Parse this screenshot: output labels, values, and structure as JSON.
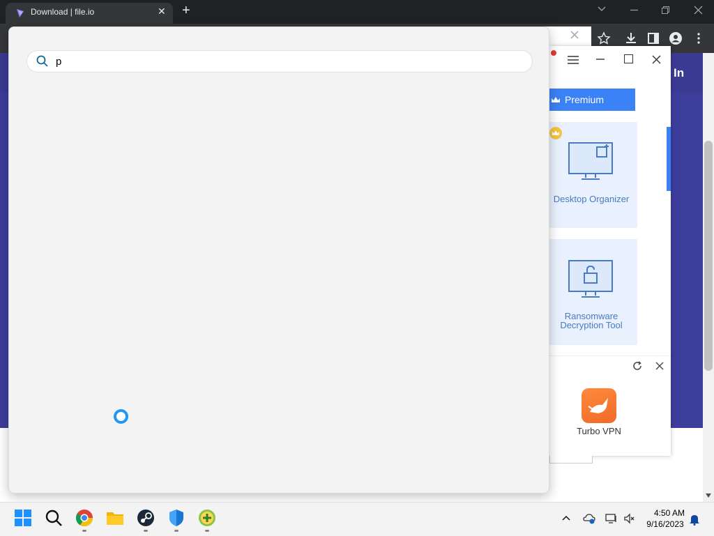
{
  "browser": {
    "tab_title": "Download | file.io",
    "tab_close": "✕",
    "new_tab": "+"
  },
  "page": {
    "sign_in_fragment": "In"
  },
  "app_panel": {
    "premium_label": "Premium",
    "tiles": [
      {
        "label": "Desktop Organizer",
        "icon": "monitor-window-icon"
      },
      {
        "label_line1": "Ransomware",
        "label_line2": "Decryption Tool",
        "icon": "monitor-lock-icon"
      }
    ],
    "promo": {
      "label": "Turbo VPN",
      "icon": "rabbit-icon"
    }
  },
  "search": {
    "query": "p"
  },
  "taskbar": {
    "time": "4:50 AM",
    "date": "9/16/2023"
  },
  "colors": {
    "page_header": "#3b3a93",
    "page_body": "#3d3d9c",
    "accent": "#3b82f6",
    "search_panel": "#f3f3f3"
  }
}
